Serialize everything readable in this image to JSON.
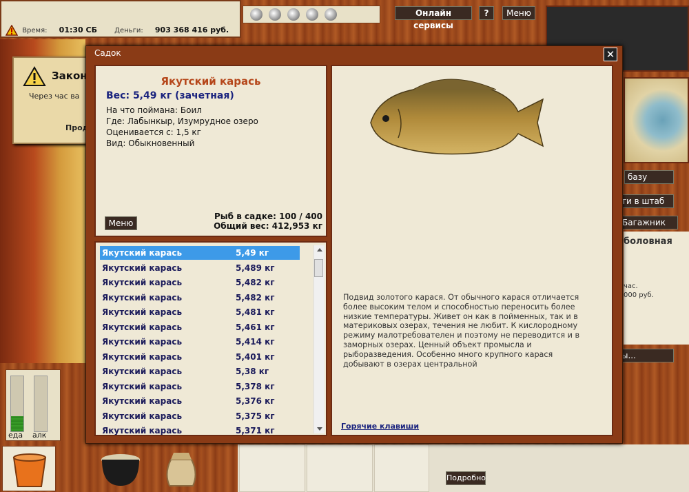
{
  "status": {
    "time_label": "Время:",
    "time_value": "01:30 СБ",
    "money_label": "Деньги:",
    "money_value": "903 368 416 руб."
  },
  "topbar": {
    "online_label": "Онлайн сервисы",
    "help_label": "?",
    "menu_label": "Меню"
  },
  "warning": {
    "title": "Закон",
    "text": "Через час ва",
    "more": "Прод"
  },
  "needs": {
    "food_label": "еда",
    "alcohol_label": "алк",
    "food_level": 0.28,
    "alcohol_level": 0
  },
  "right_panel": {
    "base_btn": "базу",
    "hq_btn": "ти в штаб",
    "trunk_btn": "Багажник",
    "title": "боловная",
    "line1": "час.",
    "line2": "000 руб.",
    "btn3": "ы..."
  },
  "bottom": {
    "detail_label": "Подробно"
  },
  "dialog": {
    "title": "Садок",
    "close_label": "✕",
    "fish_name": "Якутский карась",
    "weight_line": "Вес: 5,49 кг (зачетная)",
    "caught_on": "На что поймана: Боил",
    "where": "Где: Лабынкыр, Изумрудное озеро",
    "valued_from": "Оценивается с: 1,5 кг",
    "kind": "Вид: Обыкновенный",
    "menu_label": "Меню",
    "count_line": "Рыб в садке: 100 / 400",
    "total_line": "Общий вес: 412,953 кг",
    "description": "Подвид золотого карася. От обычного карася отличается более высоким телом и способностью переносить более низкие температуры. Живет он как в пойменных, так и в материковых озерах, течения не любит. К кислородному режиму малотребователен и поэтому не переводится и в заморных озерах. Ценный объект промысла и рыборазведения. Особенно много крупного карася добывают в озерах центральной",
    "hotkeys": "Горячие клавиши"
  },
  "fish_list": [
    {
      "name": "Якутский карась",
      "weight": "5,49 кг"
    },
    {
      "name": "Якутский карась",
      "weight": "5,489 кг"
    },
    {
      "name": "Якутский карась",
      "weight": "5,482 кг"
    },
    {
      "name": "Якутский карась",
      "weight": "5,482 кг"
    },
    {
      "name": "Якутский карась",
      "weight": "5,481 кг"
    },
    {
      "name": "Якутский карась",
      "weight": "5,461 кг"
    },
    {
      "name": "Якутский карась",
      "weight": "5,414 кг"
    },
    {
      "name": "Якутский карась",
      "weight": "5,401 кг"
    },
    {
      "name": "Якутский карась",
      "weight": "5,38 кг"
    },
    {
      "name": "Якутский карась",
      "weight": "5,378 кг"
    },
    {
      "name": "Якутский карась",
      "weight": "5,376 кг"
    },
    {
      "name": "Якутский карась",
      "weight": "5,375 кг"
    },
    {
      "name": "Якутский карась",
      "weight": "5,371 кг"
    }
  ],
  "colors": {
    "accent_name": "#b5461a",
    "weight_text": "#1a237e",
    "selected_row": "#3d9ae8",
    "wood": "#8a3b16",
    "parchment": "#efe9d6"
  }
}
